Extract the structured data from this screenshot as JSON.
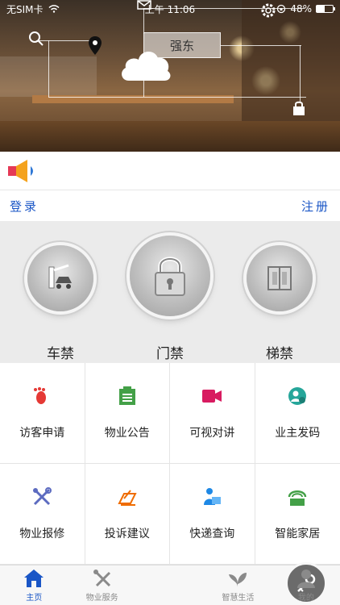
{
  "status_bar": {
    "carrier": "无SIM卡",
    "time": "上午 11:06",
    "battery": "48%",
    "battery_level": 0.48
  },
  "banner": {
    "city": "强东"
  },
  "auth": {
    "login_label": "登录",
    "register_label": "注册"
  },
  "access": [
    {
      "label": "车禁",
      "icon": "car-gate-icon"
    },
    {
      "label": "门禁",
      "icon": "padlock-icon"
    },
    {
      "label": "梯禁",
      "icon": "elevator-icon"
    }
  ],
  "services": [
    {
      "label": "访客申请",
      "icon": "footprint-icon",
      "color": "#e53935"
    },
    {
      "label": "物业公告",
      "icon": "notice-list-icon",
      "color": "#43a047"
    },
    {
      "label": "可视对讲",
      "icon": "video-camera-icon",
      "color": "#d81b60"
    },
    {
      "label": "业主发码",
      "icon": "owner-code-icon",
      "color": "#26a69a"
    },
    {
      "label": "物业报修",
      "icon": "repair-tools-icon",
      "color": "#5c6bc0"
    },
    {
      "label": "投诉建议",
      "icon": "complaint-pen-icon",
      "color": "#ef6c00"
    },
    {
      "label": "快递查询",
      "icon": "courier-icon",
      "color": "#1e88e5"
    },
    {
      "label": "智能家居",
      "icon": "smart-home-icon",
      "color": "#43a047"
    }
  ],
  "tabs": [
    {
      "label": "主页",
      "icon": "home-icon",
      "active": true
    },
    {
      "label": "物业服务",
      "icon": "tools-icon",
      "active": false
    },
    {
      "label": "",
      "icon": "key-icon",
      "active": false
    },
    {
      "label": "智慧生活",
      "icon": "leaf-icon",
      "active": false
    },
    {
      "label": "我的",
      "icon": "person-icon",
      "active": false
    }
  ],
  "colors": {
    "accent": "#1a56c6",
    "access_bg": "#ebebeb"
  }
}
